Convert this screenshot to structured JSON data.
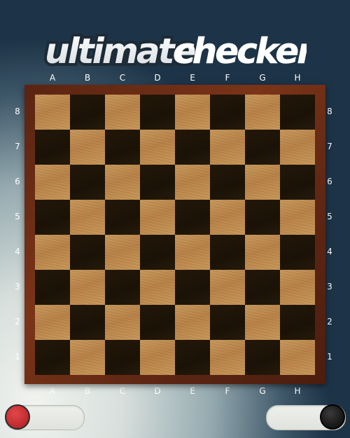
{
  "logo": {
    "part1": "ultimate",
    "part2": "checkers"
  },
  "columns": [
    "A",
    "B",
    "C",
    "D",
    "E",
    "F",
    "G",
    "H"
  ],
  "rows": [
    "8",
    "7",
    "6",
    "5",
    "4",
    "3",
    "2",
    "1"
  ],
  "colors": {
    "light_square": "#c0904f",
    "dark_square": "#1e1408",
    "board_frame": "#6a2c14",
    "player1_piece": "#d13a3d",
    "player2_piece": "#1a1a1a"
  },
  "players": [
    {
      "id": "player-red",
      "piece_color": "red"
    },
    {
      "id": "player-black",
      "piece_color": "black"
    }
  ]
}
